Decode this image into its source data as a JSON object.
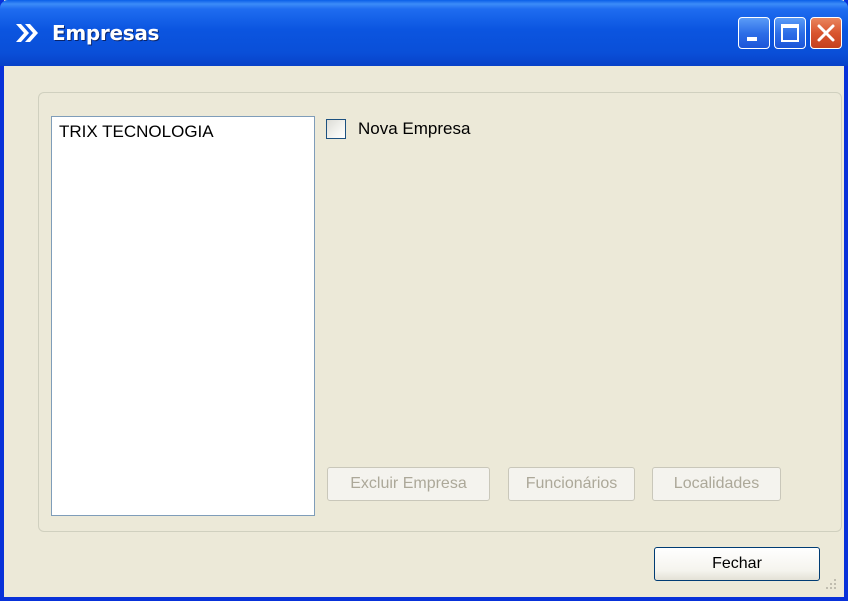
{
  "window": {
    "title": "Empresas",
    "title_icon": "chevron-double-right-icon",
    "controls": [
      "minimize-icon",
      "maximize-icon",
      "close-icon"
    ],
    "accent_color": "#0A4FD8",
    "close_color": "#D9552E",
    "background_color": "#ECE9D8"
  },
  "companies_list": {
    "items": [
      "TRIX TECNOLOGIA"
    ]
  },
  "new_company_checkbox": {
    "label": "Nova Empresa",
    "checked": false
  },
  "actions": {
    "delete_label": "Excluir Empresa",
    "employees_label": "Funcionários",
    "locations_label": "Localidades",
    "enabled": false
  },
  "footer": {
    "close_label": "Fechar"
  }
}
